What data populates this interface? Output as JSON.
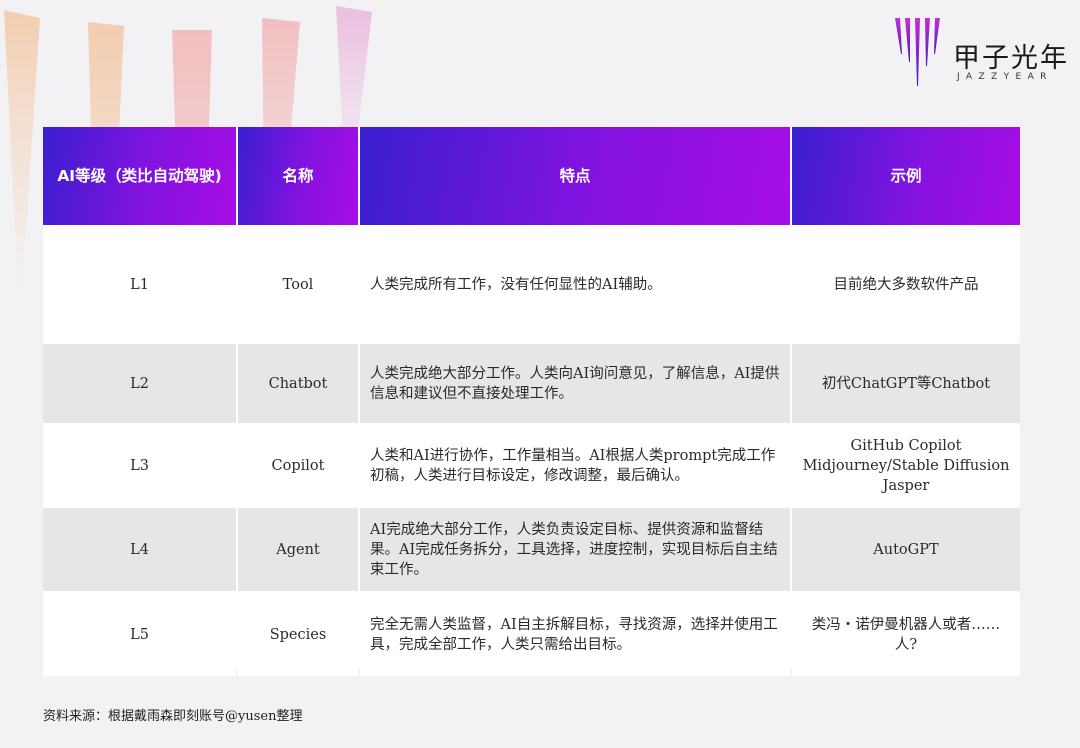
{
  "brand": {
    "name_cn": "甲子光年",
    "name_en": "JAZZYEAR"
  },
  "table": {
    "headers": [
      "AI等级（类比自动驾驶)",
      "名称",
      "特点",
      "示例"
    ],
    "rows": [
      {
        "level": "L1",
        "name": "Tool",
        "feature": "人类完成所有工作，没有任何显性的AI辅助。",
        "example_lines": [
          "目前绝大多数软件产品"
        ]
      },
      {
        "level": "L2",
        "name": "Chatbot",
        "feature": "人类完成绝大部分工作。人类向AI询问意见，了解信息，AI提供信息和建议但不直接处理工作。",
        "example_lines": [
          "初代ChatGPT等Chatbot"
        ]
      },
      {
        "level": "L3",
        "name": "Copilot",
        "feature": "人类和AI进行协作，工作量相当。AI根据人类prompt完成工作初稿，人类进行目标设定，修改调整，最后确认。",
        "example_lines": [
          "GitHub Copilot",
          "Midjourney/Stable Diffusion",
          "Jasper"
        ]
      },
      {
        "level": "L4",
        "name": "Agent",
        "feature": "AI完成绝大部分工作，人类负责设定目标、提供资源和监督结果。AI完成任务拆分，工具选择，进度控制，实现目标后自主结束工作。",
        "example_lines": [
          "AutoGPT"
        ]
      },
      {
        "level": "L5",
        "name": "Species",
        "feature": "完全无需人类监督，AI自主拆解目标，寻找资源，选择并使用工具，完成全部工作，人类只需给出目标。",
        "example_lines": [
          "类冯・诺伊曼机器人或者……",
          "人?"
        ]
      }
    ]
  },
  "footer": {
    "source": "资料来源：根据戴雨森即刻账号@yusen整理"
  },
  "colors": {
    "header_start": "#3a1fd0",
    "header_end": "#a70ee6",
    "row_alt": "#e6e6e6",
    "page_bg": "#f2f2f4"
  }
}
